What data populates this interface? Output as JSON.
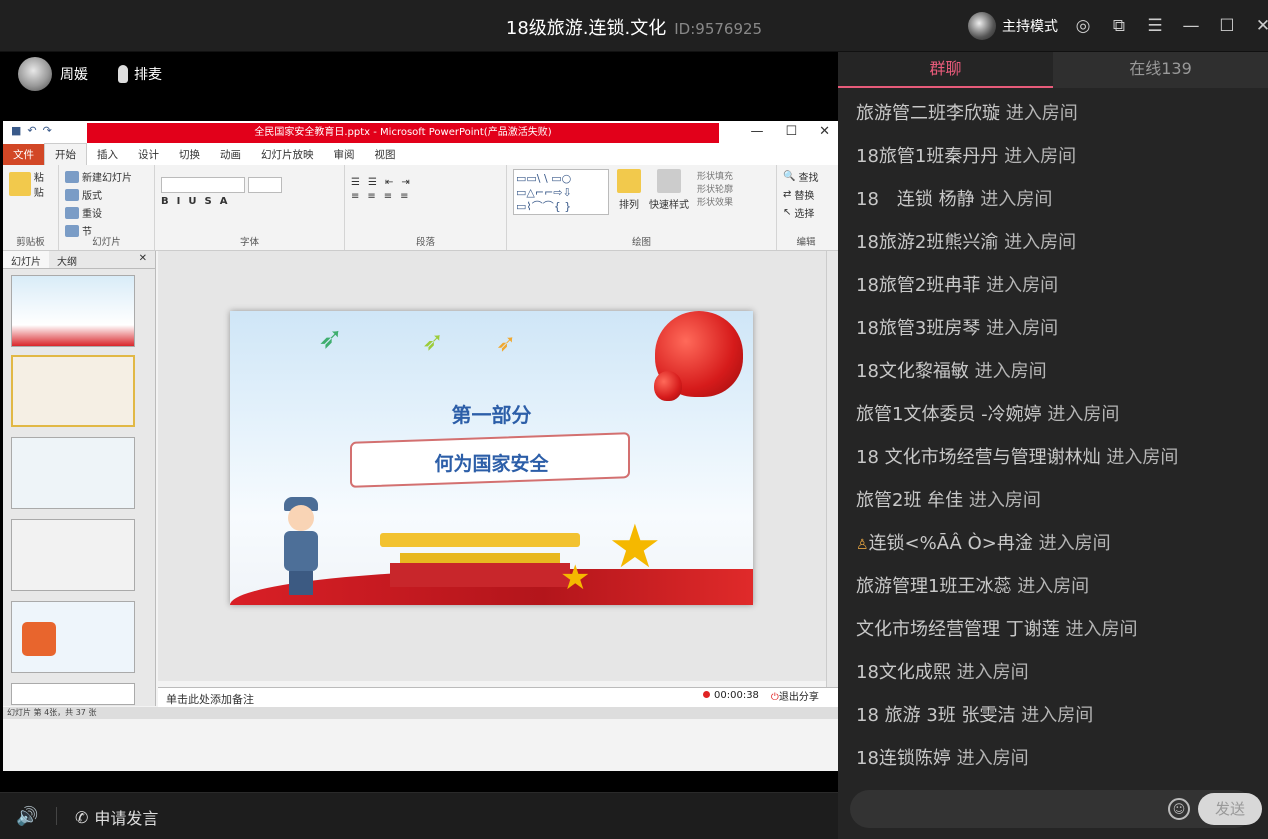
{
  "window": {
    "title": "18级旅游.连锁.文化",
    "room_id": "ID:9576925",
    "host_mode_label": "主持模式",
    "icons": [
      "settings-icon",
      "popout-icon",
      "menu-icon",
      "minimize-icon",
      "maximize-icon",
      "close-icon"
    ]
  },
  "presenter": {
    "name": "周媛",
    "mic_label": "排麦"
  },
  "ppt": {
    "window_title": "全民国家安全教育日.pptx - Microsoft PowerPoint(产品激活失败)",
    "tabs": [
      "文件",
      "开始",
      "插入",
      "设计",
      "切换",
      "动画",
      "幻灯片放映",
      "审阅",
      "视图"
    ],
    "active_tab": "开始",
    "ribbon": {
      "clipboard": {
        "paste": "粘贴",
        "label": "剪贴板"
      },
      "slides": {
        "new_slide": "新建幻灯片",
        "layout": "版式",
        "reset": "重设",
        "section": "节",
        "label": "幻灯片"
      },
      "font": {
        "label": "字体"
      },
      "paragraph": {
        "label": "段落"
      },
      "drawing": {
        "arrange": "排列",
        "quick_styles": "快速样式",
        "fill": "形状填充",
        "outline": "形状轮廓",
        "effects": "形状效果",
        "label": "绘图"
      },
      "editing": {
        "find": "查找",
        "replace": "替换",
        "select": "选择",
        "label": "编辑"
      }
    },
    "panel_tabs": [
      "幻灯片",
      "大纲"
    ],
    "slide": {
      "heading": "第一部分",
      "subheading": "何为国家安全"
    },
    "notes_placeholder": "单击此处添加备注",
    "status": "幻灯片 第 4张，共 37 张",
    "timer": "00:00:38",
    "exit_share": "退出分享"
  },
  "bottom": {
    "apply_speak": "申请发言"
  },
  "chat": {
    "tabs": [
      "群聊",
      "在线139"
    ],
    "active_tab": 0,
    "messages": [
      {
        "user": "旅游管二班李欣璇",
        "action": "进入房间"
      },
      {
        "user": "18旅管1班秦丹丹",
        "action": "进入房间"
      },
      {
        "user": "18　连锁 杨静",
        "action": "进入房间"
      },
      {
        "user": "18旅游2班熊兴渝",
        "action": "进入房间"
      },
      {
        "user": "18旅管2班冉菲",
        "action": "进入房间"
      },
      {
        "user": "18旅管3班房琴",
        "action": "进入房间"
      },
      {
        "user": "18文化黎福敏",
        "action": "进入房间"
      },
      {
        "user": "旅管1文体委员 -冷婉婷",
        "action": "进入房间"
      },
      {
        "user": "18 文化市场经营与管理谢林灿",
        "action": "进入房间"
      },
      {
        "user": "旅管2班 牟佳",
        "action": "进入房间"
      },
      {
        "user": "连锁<%ĀÂ Ò>冉淦",
        "action": "进入房间"
      },
      {
        "user": "旅游管理1班王冰蕊",
        "action": "进入房间"
      },
      {
        "user": "文化市场经营管理 丁谢莲",
        "action": "进入房间"
      },
      {
        "user": "18文化成熙",
        "action": "进入房间"
      },
      {
        "user": "18 旅游 3班 张雯洁",
        "action": "进入房间"
      },
      {
        "user": "18连锁陈婷",
        "action": "进入房间"
      }
    ],
    "send_label": "发送"
  }
}
